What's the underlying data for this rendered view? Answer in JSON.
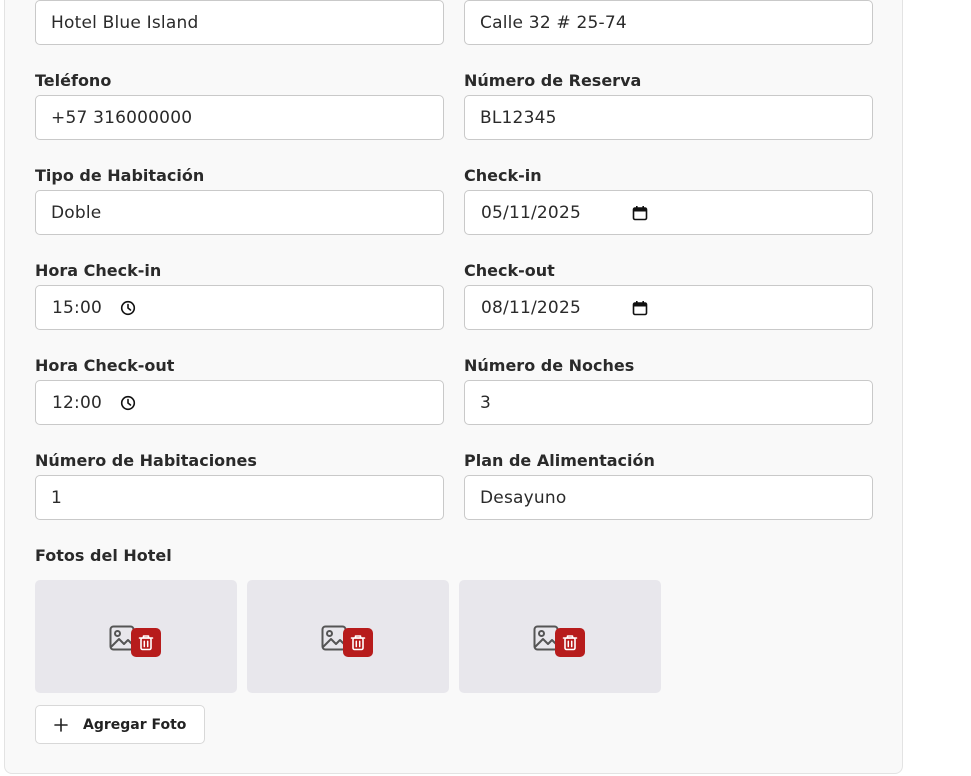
{
  "form": {
    "hotel_name": "Hotel Blue Island",
    "address": "Calle 32 # 25-74",
    "telefono_label": "Teléfono",
    "telefono": "+57 316000000",
    "reserva_label": "Número de Reserva",
    "reserva": "BL12345",
    "tipo_label": "Tipo de Habitación",
    "tipo": "Doble",
    "checkin_label": "Check-in",
    "checkin": "05/11/2025",
    "hora_checkin_label": "Hora Check-in",
    "hora_checkin": "15:00",
    "checkout_label": "Check-out",
    "checkout": "08/11/2025",
    "hora_checkout_label": "Hora Check-out",
    "hora_checkout": "12:00",
    "noches_label": "Número de Noches",
    "noches": "3",
    "habitaciones_label": "Número de Habitaciones",
    "habitaciones": "1",
    "plan_label": "Plan de Alimentación",
    "plan": "Desayuno"
  },
  "photos": {
    "label": "Fotos del Hotel",
    "count": 3,
    "add_label": "Agregar Foto"
  },
  "icons": {
    "photo_placeholder": "image-icon",
    "delete": "trash-icon",
    "time": "clock-icon",
    "date": "calendar-icon",
    "add": "plus-icon"
  },
  "colors": {
    "delete_button": "#b71c1c",
    "photo_tile": "#e8e7ec",
    "card_background": "#f9f9f9"
  }
}
